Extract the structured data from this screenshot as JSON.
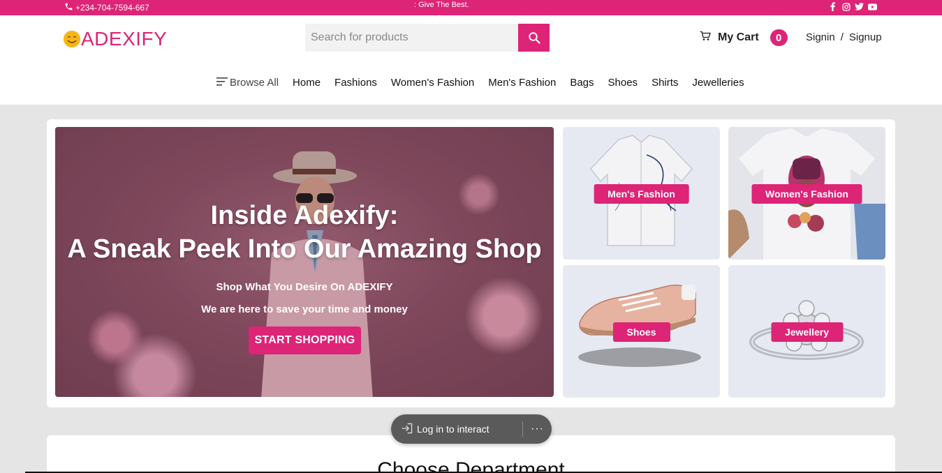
{
  "topbar": {
    "phone": "+234-704-7594-667",
    "marquee": ": Give The Best.",
    "socials": [
      "facebook-icon",
      "instagram-icon",
      "twitter-icon",
      "youtube-icon"
    ]
  },
  "header": {
    "logo": "ADEXIFY",
    "search": {
      "placeholder": "Search for products"
    },
    "cart": {
      "label": "My Cart",
      "count": "0"
    },
    "auth": {
      "signin": "Signin",
      "separator": "/",
      "signup": "Signup"
    }
  },
  "nav": {
    "browse": "Browse All",
    "items": [
      "Home",
      "Fashions",
      "Women's Fashion",
      "Men's Fashion",
      "Bags",
      "Shoes",
      "Shirts",
      "Jewelleries"
    ]
  },
  "hero": {
    "title_line1": "Inside Adexify:",
    "title_line2": "A Sneak Peek Into Our Amazing Shop",
    "sub1": "Shop What You Desire On ADEXIFY",
    "sub2": "We are here to save your time and money",
    "cta": "START SHOPPING"
  },
  "categories": [
    {
      "label": "Men's Fashion"
    },
    {
      "label": "Women's Fashion"
    },
    {
      "label": "Shoes"
    },
    {
      "label": "Jewellery"
    }
  ],
  "toast": {
    "login": "Log in to interact",
    "more": "···"
  },
  "department": {
    "title": "Choose Department"
  },
  "colors": {
    "brand": "#dd2476",
    "logo_face": "#f5b718"
  }
}
